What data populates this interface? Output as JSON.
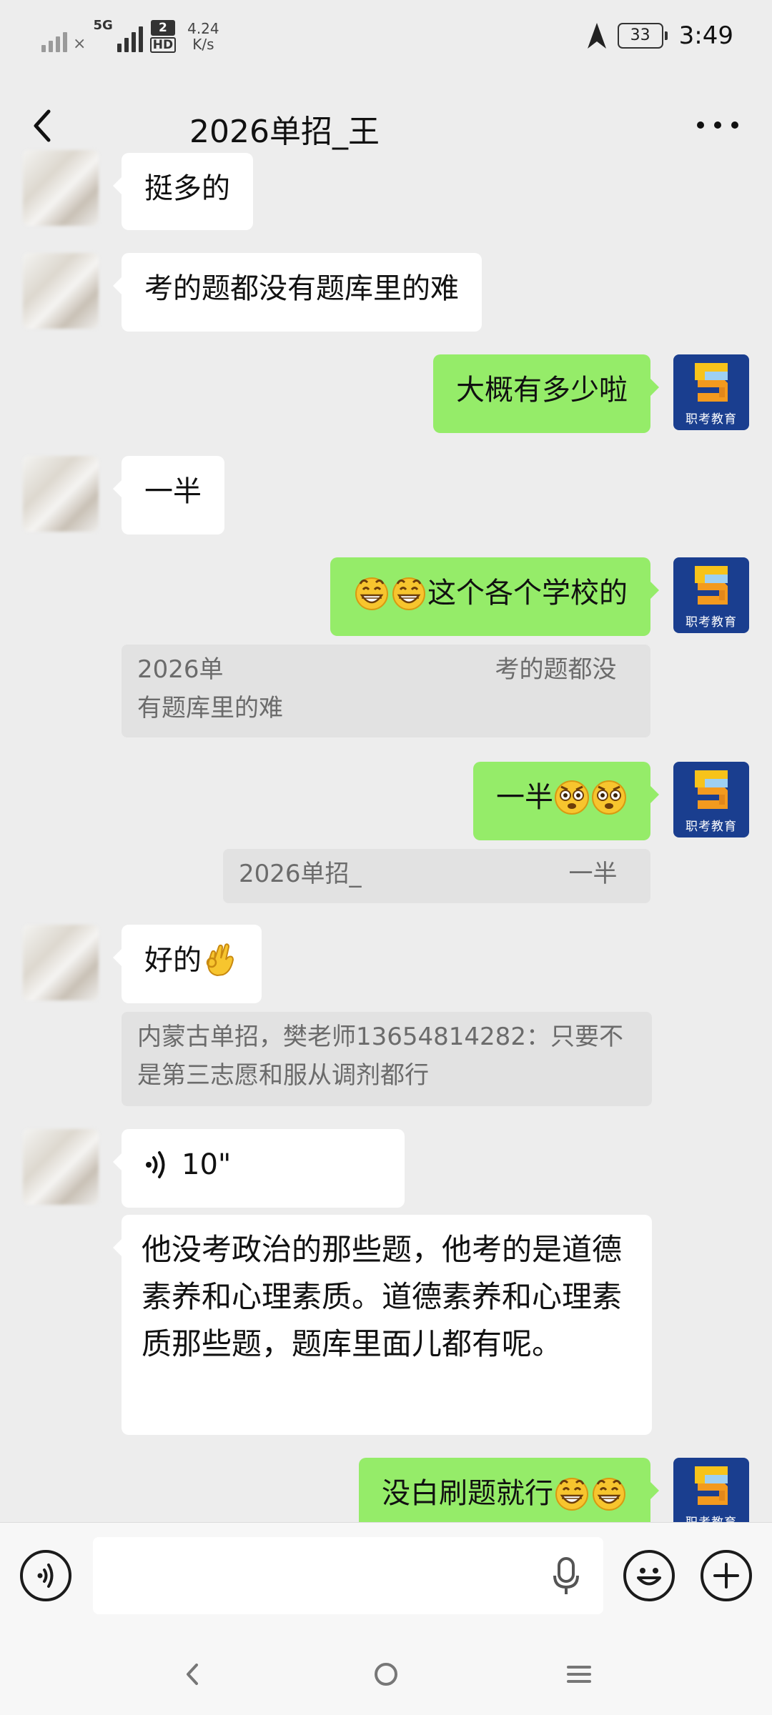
{
  "status_bar": {
    "network_5g": "5G",
    "sim2_number": "2",
    "sim2_hd": "HD",
    "speed_value": "4.24",
    "speed_unit": "K/s",
    "battery": "33",
    "time": "3:49"
  },
  "header": {
    "title": "2026单招_王",
    "back_icon": "back-chevron-icon",
    "more_icon": "more-dots-icon"
  },
  "brand_avatar": {
    "text": "职考教育",
    "colors": {
      "bg": "#1a3e8f",
      "orange": "#f39a1e",
      "yellow": "#f7c31a",
      "light": "#9ed0f2"
    }
  },
  "colors": {
    "chat_bg": "#ededed",
    "outgoing_bubble": "#95ec69",
    "incoming_bubble": "#ffffff",
    "quote_bg": "#e2e2e2"
  },
  "messages": {
    "m1": {
      "text": "挺多的"
    },
    "m2": {
      "text": "考的题都没有题库里的难"
    },
    "m3": {
      "text": "大概有多少啦"
    },
    "m4": {
      "text": "一半"
    },
    "m5": {
      "text": "这个各个学校的",
      "emoji": [
        "grin-emoji",
        "grin-emoji"
      ]
    },
    "q1": {
      "part1": "2026单",
      "part2": "考的题都没",
      "part3": "有题库里的难"
    },
    "m6": {
      "text": "一半",
      "emoji": [
        "flushed-emoji",
        "flushed-emoji"
      ]
    },
    "q2": {
      "part1": "2026单招_",
      "part2": "一半"
    },
    "m7": {
      "text": "好的",
      "emoji": [
        "ok-hand-emoji"
      ]
    },
    "q3": {
      "text": "内蒙古单招，樊老师13654814282：只要不是第三志愿和服从调剂都行"
    },
    "m8": {
      "voice_duration": "10\""
    },
    "m9": {
      "text": "他没考政治的那些题，他考的是道德素养和心理素质。道德素养和心理素质那些题，题库里面儿都有呢。"
    },
    "m10": {
      "text": "没白刷题就行",
      "emoji": [
        "grin-emoji",
        "grin-emoji"
      ]
    }
  },
  "input_bar": {
    "voice_icon": "voice-input-icon",
    "mic_icon": "microphone-icon",
    "emoji_icon": "emoji-icon",
    "plus_icon": "plus-icon",
    "text_value": ""
  },
  "nav_bar": {
    "back_icon": "nav-back-icon",
    "home_icon": "nav-home-icon",
    "recents_icon": "nav-menu-icon"
  }
}
